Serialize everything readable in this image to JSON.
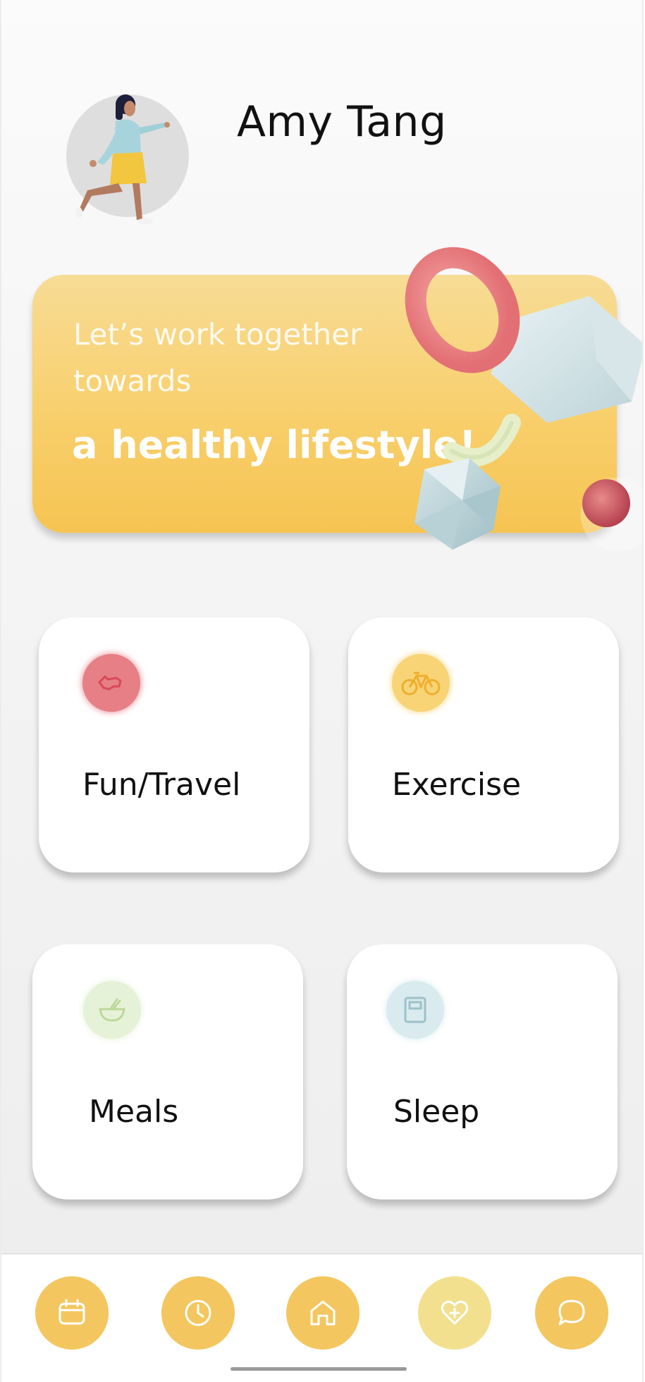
{
  "profile": {
    "name": "Amy Tang"
  },
  "banner": {
    "line1": "Let’s work together towards",
    "line2": "a healthy lifestyle!"
  },
  "cards": [
    {
      "label": "Fun/Travel",
      "icon": "airplane-icon",
      "color": "#e67f86"
    },
    {
      "label": "Exercise",
      "icon": "bicycle-icon",
      "color": "#f8cf6c"
    },
    {
      "label": "Meals",
      "icon": "bowl-icon",
      "color": "#e6f2d8"
    },
    {
      "label": "Sleep",
      "icon": "book-icon",
      "color": "#d9ebee"
    }
  ],
  "nav": [
    {
      "icon": "calendar-icon"
    },
    {
      "icon": "clock-icon"
    },
    {
      "icon": "home-icon"
    },
    {
      "icon": "heart-plus-icon"
    },
    {
      "icon": "chat-icon"
    }
  ],
  "colors": {
    "accent": "#f3c65f",
    "accent_light": "#f2e08f",
    "banner_top": "#f7dc95",
    "banner_bottom": "#f6c452"
  }
}
